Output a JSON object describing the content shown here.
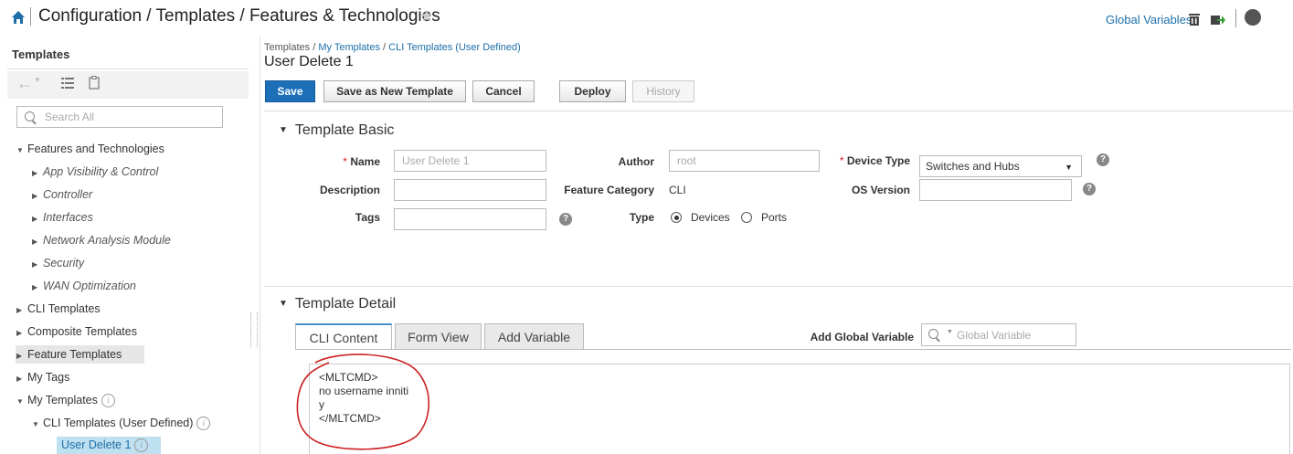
{
  "header": {
    "page_crumb": "Configuration / Templates / Features & Technologies",
    "global_variables_link": "Global Variables",
    "icons": [
      "home-icon",
      "star-icon",
      "trash-icon",
      "export-icon",
      "help-icon"
    ]
  },
  "sidebar": {
    "title": "Templates",
    "search_placeholder": "Search All",
    "tree": [
      {
        "label": "Features and Technologies",
        "expanded": true
      },
      {
        "label": "App Visibility & Control"
      },
      {
        "label": "Controller"
      },
      {
        "label": "Interfaces"
      },
      {
        "label": "Network Analysis Module"
      },
      {
        "label": "Security"
      },
      {
        "label": "WAN Optimization"
      },
      {
        "label": "CLI Templates"
      },
      {
        "label": "Composite Templates"
      },
      {
        "label": "Feature Templates"
      },
      {
        "label": "My Tags"
      },
      {
        "label": "My Templates",
        "expanded": true
      },
      {
        "label": "CLI Templates (User Defined)",
        "expanded": true
      },
      {
        "label": "User Delete 1",
        "selected": true
      }
    ]
  },
  "main": {
    "breadcrumb": {
      "root": "Templates",
      "sep": " / ",
      "path1": "My Templates",
      "path2": "CLI Templates (User Defined)"
    },
    "title": "User Delete 1",
    "buttons": {
      "save": "Save",
      "save_as_new": "Save as New Template",
      "cancel": "Cancel",
      "deploy": "Deploy",
      "history": "History"
    },
    "basic": {
      "section_title": "Template Basic",
      "name_label": "Name",
      "name_value": "User Delete 1",
      "description_label": "Description",
      "description_value": "",
      "tags_label": "Tags",
      "tags_value": "",
      "author_label": "Author",
      "author_value": "root",
      "feature_category_label": "Feature Category",
      "feature_category_value": "CLI",
      "type_label": "Type",
      "type_options": [
        "Devices",
        "Ports"
      ],
      "type_selected": "Devices",
      "device_type_label": "Device Type",
      "device_type_value": "Switches and Hubs",
      "os_version_label": "OS Version",
      "os_version_value": ""
    },
    "detail": {
      "section_title": "Template Detail",
      "tabs": [
        {
          "label": "CLI Content",
          "active": true
        },
        {
          "label": "Form View"
        },
        {
          "label": "Add Variable"
        }
      ],
      "add_global_variable_label": "Add Global Variable",
      "global_variable_placeholder": "Global Variable",
      "cli_content": [
        "<MLTCMD>",
        "no username inniti",
        "y",
        "</MLTCMD>"
      ]
    }
  },
  "colors": {
    "primary_button": "#1d70b7",
    "link": "#1d6fa8",
    "annotation": "#cc2222",
    "selected_row": "#bfe0f0"
  }
}
